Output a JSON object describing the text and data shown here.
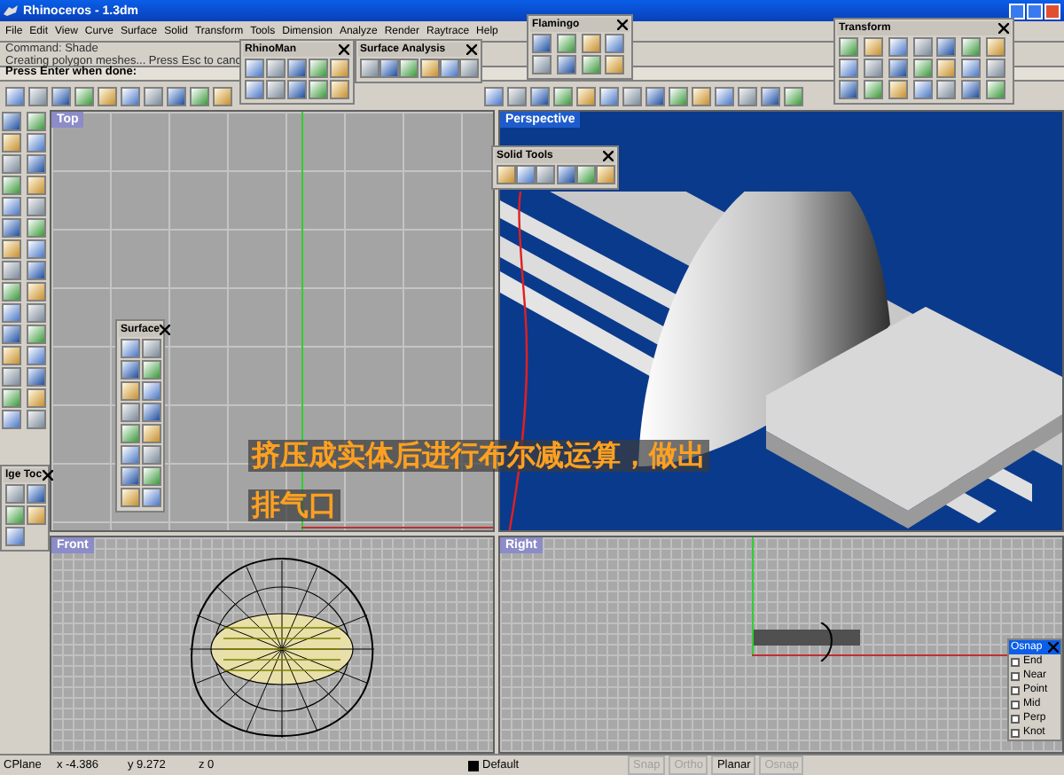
{
  "window": {
    "title": "Rhinoceros - 1.3dm"
  },
  "menu": [
    "File",
    "Edit",
    "View",
    "Curve",
    "Surface",
    "Solid",
    "Transform",
    "Tools",
    "Dimension",
    "Analyze",
    "Render",
    "Raytrace",
    "Help"
  ],
  "command_lines": [
    "Command: Shade",
    "Creating polygon meshes... Press Esc to canc"
  ],
  "prompt": "Press Enter when done:",
  "floating_toolbars": [
    {
      "title": "RhinoMan"
    },
    {
      "title": "Surface Analysis"
    },
    {
      "title": "Flamingo"
    },
    {
      "title": "Transform"
    },
    {
      "title": "Solid Tools"
    },
    {
      "title": "Surface"
    },
    {
      "title": "lge Toc"
    }
  ],
  "viewports": [
    {
      "title": "Top",
      "active": false
    },
    {
      "title": "Perspective",
      "active": true
    },
    {
      "title": "Front",
      "active": false
    },
    {
      "title": "Right",
      "active": false
    }
  ],
  "annotation": [
    "挤压成实体后进行布尔减运算，做出",
    "排气口"
  ],
  "osnap": {
    "title": "Osnap",
    "items": [
      {
        "label": "End",
        "checked": false
      },
      {
        "label": "Near",
        "checked": false
      },
      {
        "label": "Point",
        "checked": false
      },
      {
        "label": "Mid",
        "checked": false
      },
      {
        "label": "Perp",
        "checked": false
      },
      {
        "label": "Knot",
        "checked": false
      }
    ]
  },
  "status_bar": {
    "cplane": "CPlane",
    "x": "x -4.386",
    "y": "y 9.272",
    "z": "z 0",
    "layer": "Default",
    "toggles": [
      {
        "label": "Snap",
        "on": false
      },
      {
        "label": "Ortho",
        "on": false
      },
      {
        "label": "Planar",
        "on": true
      },
      {
        "label": "Osnap",
        "on": false
      }
    ]
  }
}
